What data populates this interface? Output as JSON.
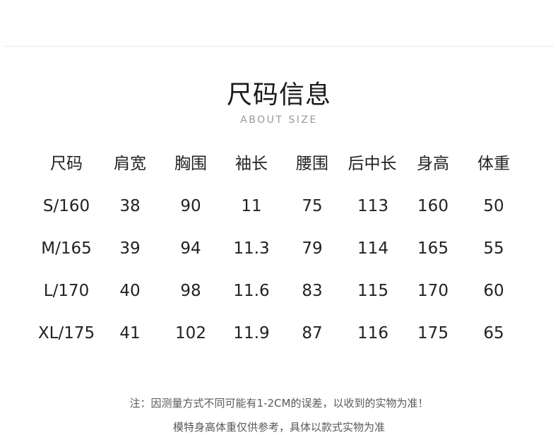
{
  "section": {
    "title": "尺码信息",
    "subtitle": "ABOUT SIZE"
  },
  "size_table": {
    "headers": [
      "尺码",
      "肩宽",
      "胸围",
      "袖长",
      "腰围",
      "后中长",
      "身高",
      "体重"
    ],
    "rows": [
      [
        "S/160",
        "38",
        "90",
        "11",
        "75",
        "113",
        "160",
        "50"
      ],
      [
        "M/165",
        "39",
        "94",
        "11.3",
        "79",
        "114",
        "165",
        "55"
      ],
      [
        "L/170",
        "40",
        "98",
        "11.6",
        "83",
        "115",
        "170",
        "60"
      ],
      [
        "XL/175",
        "41",
        "102",
        "11.9",
        "87",
        "116",
        "175",
        "65"
      ]
    ]
  },
  "notes": {
    "line1": "注：因测量方式不同可能有1-2CM的误差，以收到的实物为准！",
    "line2": "模特身高体重仅供参考，具体以款式实物为准"
  }
}
